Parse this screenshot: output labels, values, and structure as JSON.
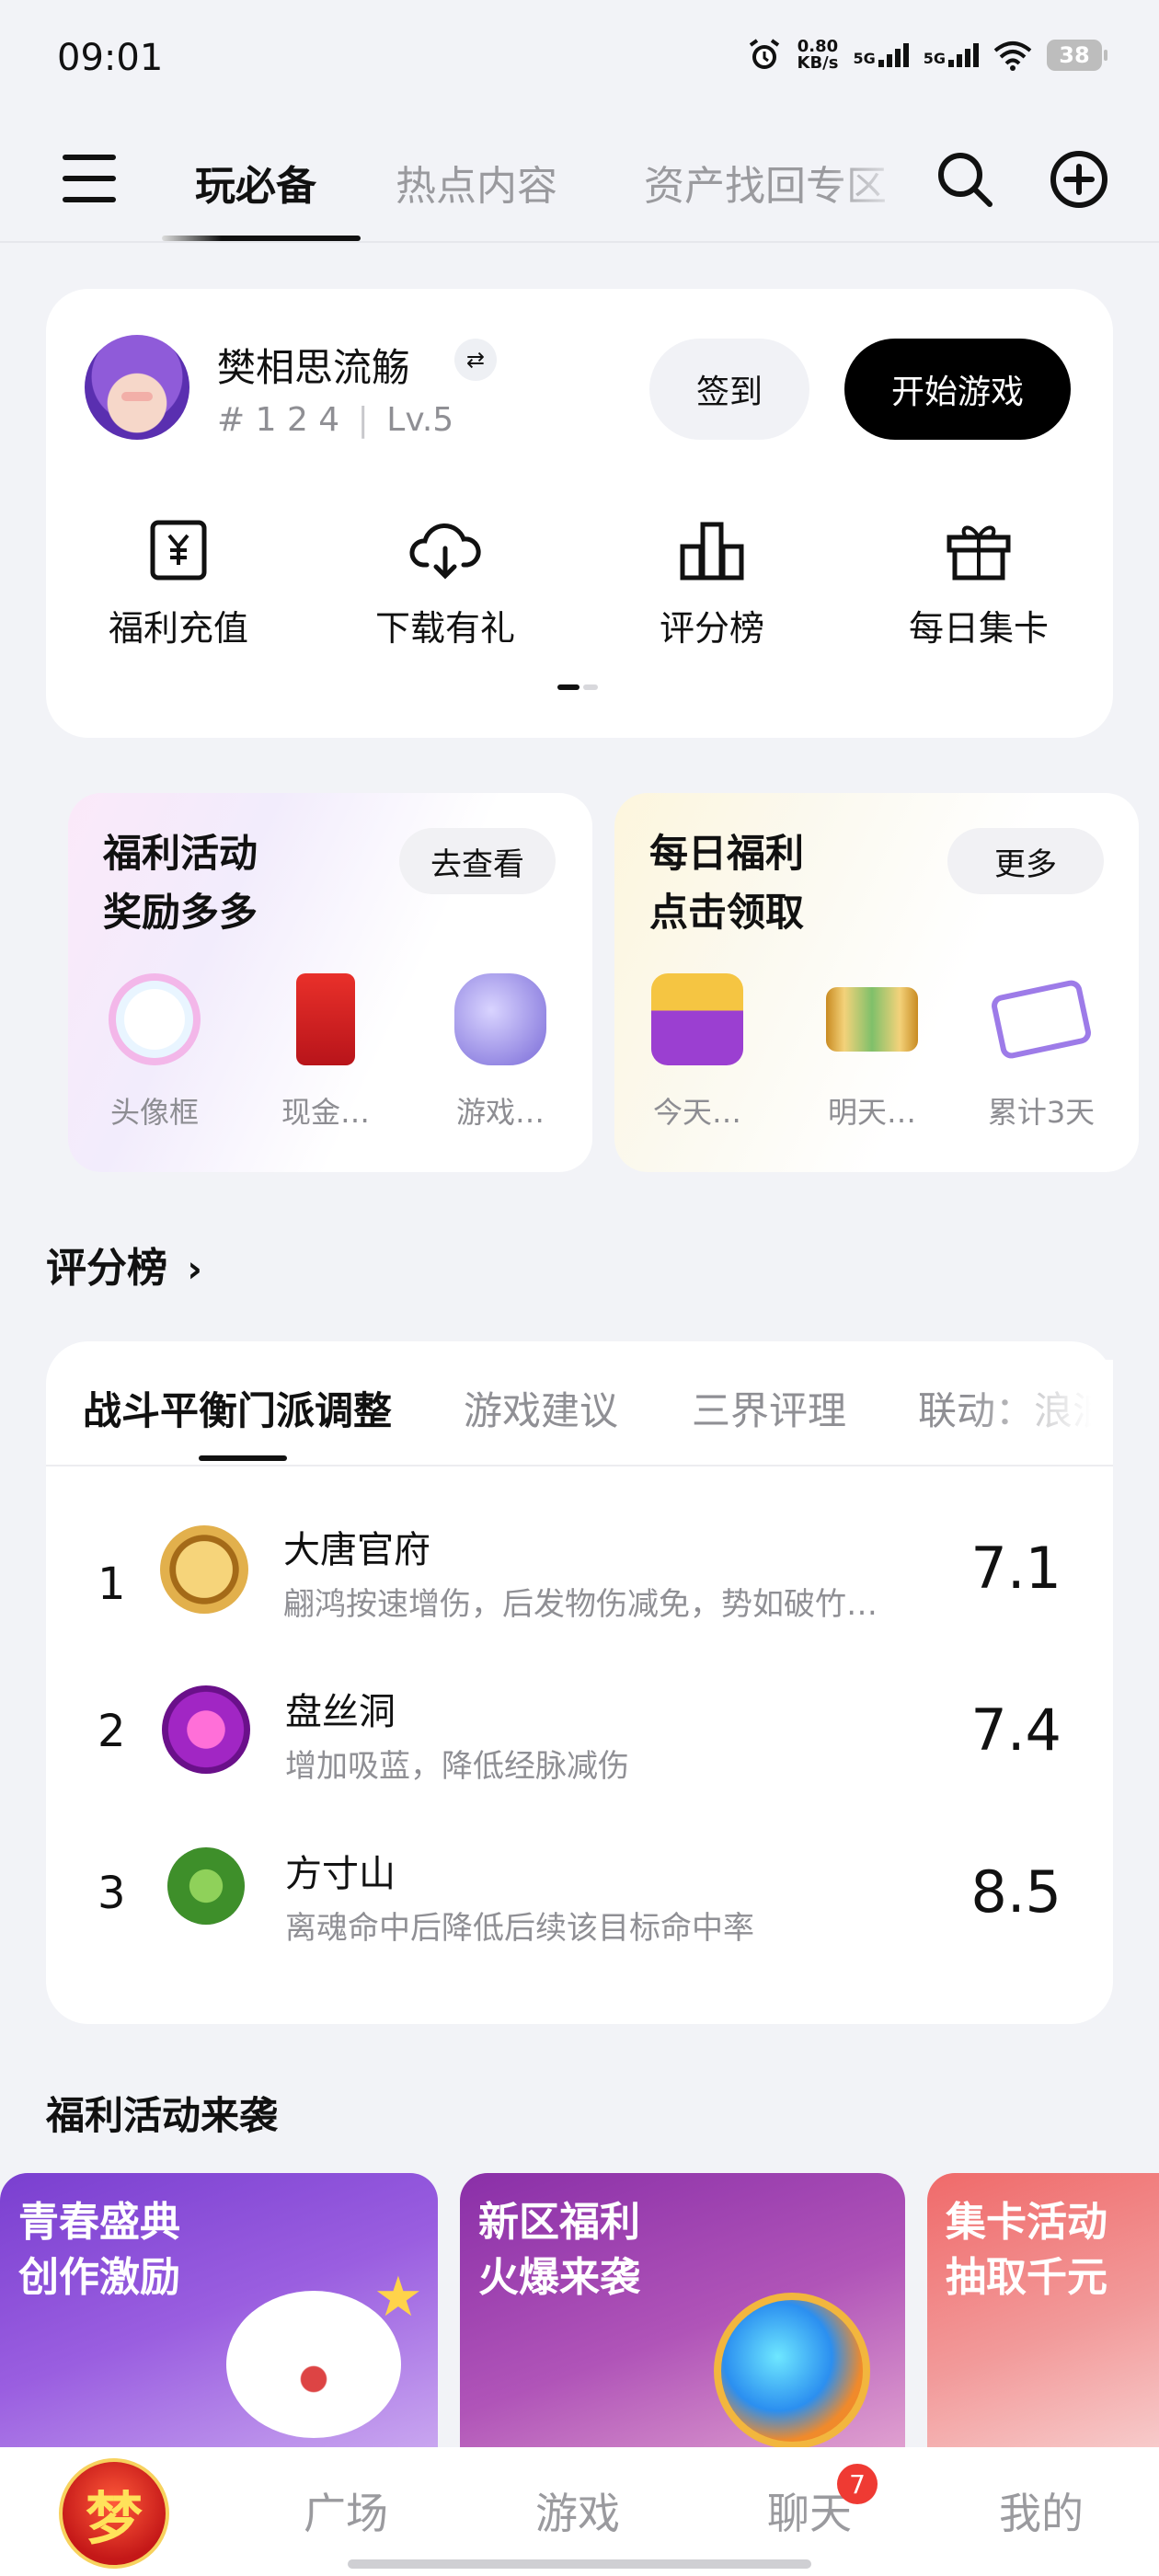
{
  "status_bar": {
    "time": "09:01",
    "speed_value": "0.80",
    "speed_unit": "KB/s",
    "sim1": "5G",
    "sim2": "5G",
    "battery": "38"
  },
  "top_nav": {
    "tabs": [
      {
        "label": "玩必备",
        "active": true
      },
      {
        "label": "热点内容",
        "active": false
      },
      {
        "label": "资产找回专区",
        "active": false
      }
    ]
  },
  "profile": {
    "name": "樊相思流觞",
    "server_id": "# 1 2 4",
    "separator": "|",
    "level": "Lv.5",
    "sign_in_label": "签到",
    "start_game_label": "开始游戏",
    "quick_actions": [
      {
        "label": "福利充值",
        "icon": "yuan-card-icon"
      },
      {
        "label": "下载有礼",
        "icon": "cloud-download-icon"
      },
      {
        "label": "评分榜",
        "icon": "bar-chart-icon"
      },
      {
        "label": "每日集卡",
        "icon": "gift-icon"
      }
    ]
  },
  "benefit_cards": [
    {
      "title_line1": "福利活动",
      "title_line2": "奖励多多",
      "action_label": "去查看",
      "items": [
        "头像框",
        "现金…",
        "游戏…"
      ]
    },
    {
      "title_line1": "每日福利",
      "title_line2": "点击领取",
      "action_label": "更多",
      "items": [
        "今天…",
        "明天…",
        "累计3天"
      ]
    }
  ],
  "rating": {
    "section_title": "评分榜",
    "tabs": [
      {
        "label": "战斗平衡门派调整",
        "active": true
      },
      {
        "label": "游戏建议",
        "active": false
      },
      {
        "label": "三界评理",
        "active": false
      },
      {
        "label": "联动：浪浪",
        "active": false
      }
    ],
    "rows": [
      {
        "rank": "1",
        "name": "大唐官府",
        "desc": "翩鸿按速增伤，后发物伤减免，势如破竹…",
        "score": "7.1"
      },
      {
        "rank": "2",
        "name": "盘丝洞",
        "desc": "增加吸蓝，降低经脉减伤",
        "score": "7.4"
      },
      {
        "rank": "3",
        "name": "方寸山",
        "desc": "离魂命中后降低后续该目标命中率",
        "score": "8.5"
      }
    ]
  },
  "promos": {
    "section_title": "福利活动来袭",
    "cards": [
      {
        "line1": "青春盛典",
        "line2": "创作激励"
      },
      {
        "line1": "新区福利",
        "line2": "火爆来袭"
      },
      {
        "line1": "集卡活动",
        "line2": "抽取千元"
      }
    ]
  },
  "bottom_nav": {
    "logo_text": "梦",
    "items": [
      "广场",
      "游戏",
      "聊天",
      "我的"
    ],
    "chat_badge": "7"
  },
  "colors": {
    "background": "#f2f3f7",
    "card": "#ffffff",
    "primary_button": "#000000",
    "muted_text": "#8f8f94",
    "badge": "#ef3a33"
  }
}
